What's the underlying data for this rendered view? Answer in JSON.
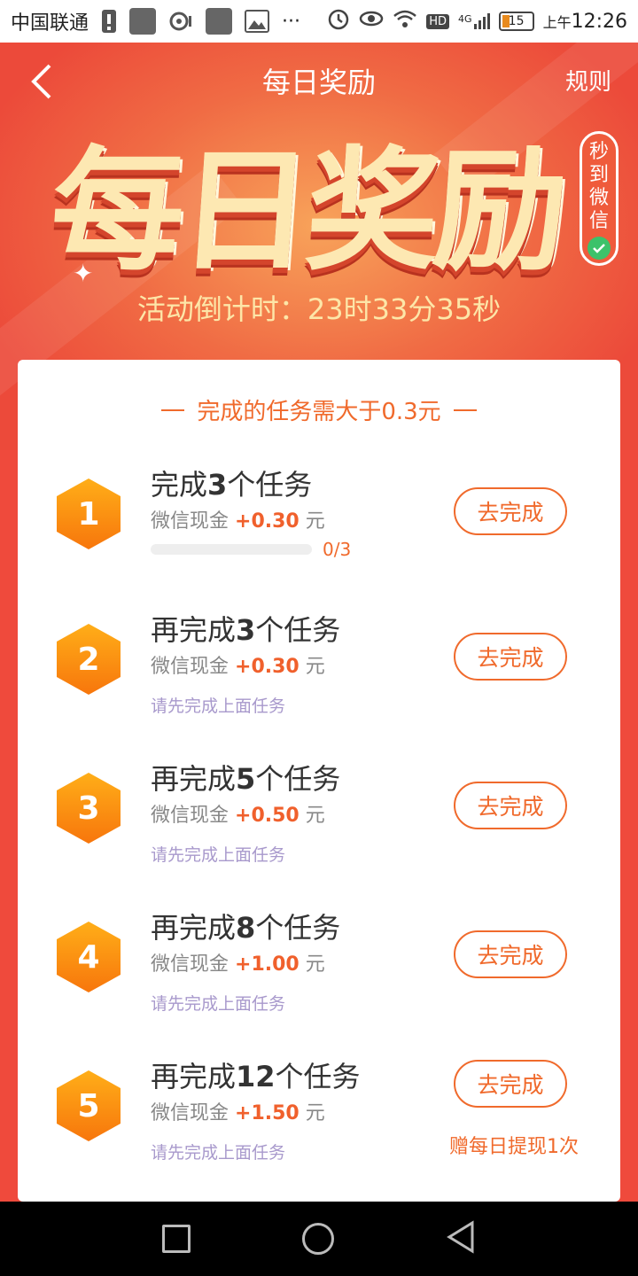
{
  "status_bar": {
    "carrier": "中国联通",
    "network": "4G",
    "hd": "HD",
    "battery": "15",
    "time_prefix": "上午",
    "time": "12:26"
  },
  "header": {
    "title": "每日奖励",
    "rules_label": "规则",
    "banner_chars": [
      "每",
      "日",
      "奖",
      "励"
    ],
    "badge_chars": [
      "秒",
      "到",
      "微",
      "信"
    ],
    "countdown": "活动倒计时：23时33分35秒"
  },
  "card": {
    "header_text": "完成的任务需大于0.3元",
    "reward_prefix": "微信现金",
    "unit": "元",
    "tasks": [
      {
        "index": "1",
        "name_prefix": "完成",
        "count": "3",
        "name_suffix": "个任务",
        "amount": "+0.30",
        "button": "去完成",
        "progress_text": "0/3",
        "progress_value": 0
      },
      {
        "index": "2",
        "name_prefix": "再完成",
        "count": "3",
        "name_suffix": "个任务",
        "amount": "+0.30",
        "button": "去完成",
        "hint": "请先完成上面任务"
      },
      {
        "index": "3",
        "name_prefix": "再完成",
        "count": "5",
        "name_suffix": "个任务",
        "amount": "+0.50",
        "button": "去完成",
        "hint": "请先完成上面任务"
      },
      {
        "index": "4",
        "name_prefix": "再完成",
        "count": "8",
        "name_suffix": "个任务",
        "amount": "+1.00",
        "button": "去完成",
        "hint": "请先完成上面任务"
      },
      {
        "index": "5",
        "name_prefix": "再完成",
        "count": "12",
        "name_suffix": "个任务",
        "amount": "+1.50",
        "button": "去完成",
        "hint": "请先完成上面任务",
        "bonus": "赠每日提现1次"
      }
    ]
  },
  "colors": {
    "accent": "#f06a2c",
    "header_bg": "#ef4a3c",
    "hex_badge": "#f7760c",
    "hint": "#a899cc"
  }
}
